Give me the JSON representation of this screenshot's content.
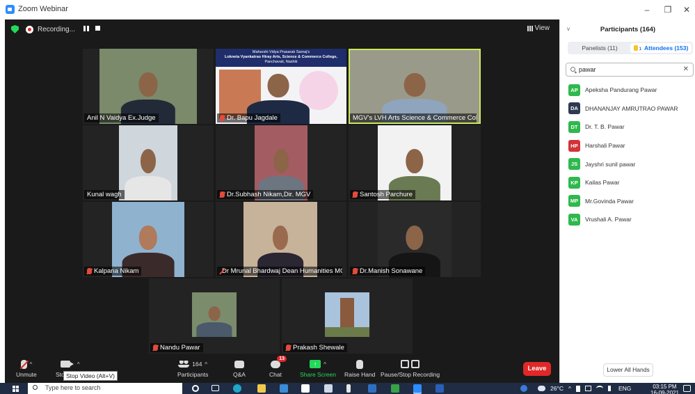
{
  "window": {
    "title": "Zoom Webinar",
    "min": "–",
    "max": "❐",
    "close": "✕"
  },
  "meeting": {
    "recording_label": "Recording...",
    "view_label": "View",
    "tiles": [
      {
        "name": "Anil N Vaidya Ex.Judge",
        "muted": false,
        "active": false
      },
      {
        "name": "Dr. Bapu Jagdale",
        "muted": true,
        "active": false
      },
      {
        "name": "MGV's LVH Arts Science & Commerce College Pa...",
        "muted": false,
        "active": true
      },
      {
        "name": "Kunal wagh",
        "muted": false,
        "active": false
      },
      {
        "name": "Dr.Subhash Nikam,Dir. MGV",
        "muted": true,
        "active": false
      },
      {
        "name": "Santosh Parchure",
        "muted": true,
        "active": false
      },
      {
        "name": "Kalpana Nikam",
        "muted": true,
        "active": false
      },
      {
        "name": "Dr Mrunal Bhardwaj Dean  Humanities MG Vi...",
        "muted": true,
        "active": false
      },
      {
        "name": "Dr.Manish Sonawane",
        "muted": true,
        "active": false
      },
      {
        "name": "Nandu Pawar",
        "muted": true,
        "active": false
      },
      {
        "name": "Prakash Shewale",
        "muted": true,
        "active": false
      }
    ],
    "banner": {
      "line1": "Maharshi Vidya Prasarak Samaj's",
      "line2": "Lokneta Vyankatrao Hiray Arts, Science & Commerce College,",
      "line3": "Panchavati, Nashik"
    }
  },
  "toolbar": {
    "unmute": "Unmute",
    "stop_video": "Stop Video",
    "stop_video_tooltip": "Stop Video (Alt+V)",
    "participants": "Participants",
    "participants_count": "164",
    "qa": "Q&A",
    "chat": "Chat",
    "chat_badge": "13",
    "share_screen": "Share Screen",
    "raise_hand": "Raise Hand",
    "pause_stop": "Pause/Stop Recording",
    "leave": "Leave"
  },
  "panel": {
    "title": "Participants (164)",
    "tab_panelists": "Panelists (11)",
    "tab_attendees_count": "1",
    "tab_attendees": "Attendees (153)",
    "search_value": "pawar",
    "lower_all": "Lower All Hands",
    "participants": [
      {
        "initials": "AP",
        "name": "Apeksha Pandurang Pawar",
        "color": "#2fb84d"
      },
      {
        "initials": "DA",
        "name": "DHANANJAY AMRUTRAO PAWAR",
        "color": "#2d3a50"
      },
      {
        "initials": "DT",
        "name": "Dr. T. B. Pawar",
        "color": "#2fb84d"
      },
      {
        "initials": "HP",
        "name": "Harshali Pawar",
        "color": "#d13438"
      },
      {
        "initials": "JS",
        "name": "Jayshri sunil pawar",
        "color": "#2fb84d"
      },
      {
        "initials": "KP",
        "name": "Kailas Pawar",
        "color": "#2fb84d"
      },
      {
        "initials": "MP",
        "name": "Mr.Govinda Pawar",
        "color": "#2fb84d"
      },
      {
        "initials": "VA",
        "name": "Vrushali A. Pawar",
        "color": "#2fb84d"
      }
    ]
  },
  "taskbar": {
    "search_placeholder": "Type here to search",
    "weather": "26°C",
    "language": "ENG",
    "time": "03:15 PM",
    "date": "16-09-2021"
  }
}
